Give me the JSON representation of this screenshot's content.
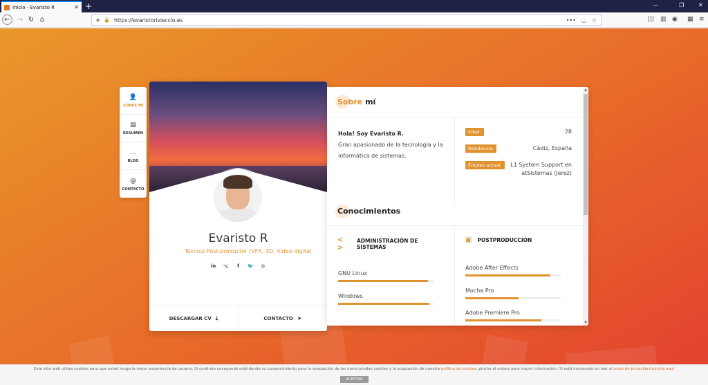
{
  "browser": {
    "tab_title": "Inicio - Evaristo R",
    "tab_close": "✕",
    "new_tab": "+",
    "url": "https://evaristorivieccio.es",
    "window_controls": [
      "—",
      "❐",
      "✕"
    ]
  },
  "nav": {
    "items": [
      {
        "label": "SOBRE MÍ",
        "icon": "user-icon",
        "glyph": "👤"
      },
      {
        "label": "RESUMEN",
        "icon": "document-icon",
        "glyph": "▤"
      },
      {
        "label": "BLOG",
        "icon": "chat-icon",
        "glyph": "…"
      },
      {
        "label": "CONTACTO",
        "icon": "at-icon",
        "glyph": "@"
      }
    ]
  },
  "profile": {
    "name": "Evaristo R",
    "subtitle": "Técnico Post-productor (VFX, 3D, Vídeo digital",
    "socials": [
      {
        "icon": "linkedin-icon",
        "glyph": "in"
      },
      {
        "icon": "github-icon",
        "glyph": "⌥"
      },
      {
        "icon": "facebook-icon",
        "glyph": "f"
      },
      {
        "icon": "twitter-icon",
        "glyph": "🐦"
      },
      {
        "icon": "instagram-icon",
        "glyph": "◎"
      }
    ],
    "download_cv": "DESCARGAR CV",
    "contact": "CONTACTO"
  },
  "about": {
    "title_accent": "Sobre",
    "title_rest": " mí",
    "greeting": "Hola! Soy Evaristo R.",
    "description": "Gran apasionado de la tecnología y la informática de sistemas.",
    "info": [
      {
        "key": "Edad:",
        "value": "28"
      },
      {
        "key": "Residencia:",
        "value": "Cádiz, España"
      },
      {
        "key": "Empleo actual:",
        "value": "L1 System Support en atSistemas (Jerez)"
      }
    ]
  },
  "skills": {
    "title": "Conocimientos",
    "groups": [
      {
        "title": "ADMINISTRACIÓN DE SISTEMAS",
        "icon": "code-icon",
        "items": [
          {
            "name": "GNU Linux",
            "level": 0.94
          },
          {
            "name": "Windows",
            "level": 0.96
          }
        ]
      },
      {
        "title": "POSTPRODUCCIÓN",
        "icon": "easel-icon",
        "items": [
          {
            "name": "Adobe After Effects",
            "level": 0.89
          },
          {
            "name": "Mocha Pro",
            "level": 0.56
          },
          {
            "name": "Adobe Premiere Pro",
            "level": 0.8
          }
        ]
      }
    ]
  },
  "cookie": {
    "text_before": "Este sitio web utiliza cookies para que usted tenga la mejor experiencia de usuario. Si continúa navegando está dando su consentimiento para la aceptación de las mencionadas cookies y la aceptación de nuestra ",
    "link1": "política de cookies",
    "text_middle": ", pinche el enlace para mayor información. Si está interesado en leer el ",
    "link2": "aviso de privacidad pinche aquí",
    "button": "ACEPTAR"
  },
  "colors": {
    "accent": "#e0922f",
    "background_start": "#e9972a",
    "background_end": "#e2402f"
  }
}
